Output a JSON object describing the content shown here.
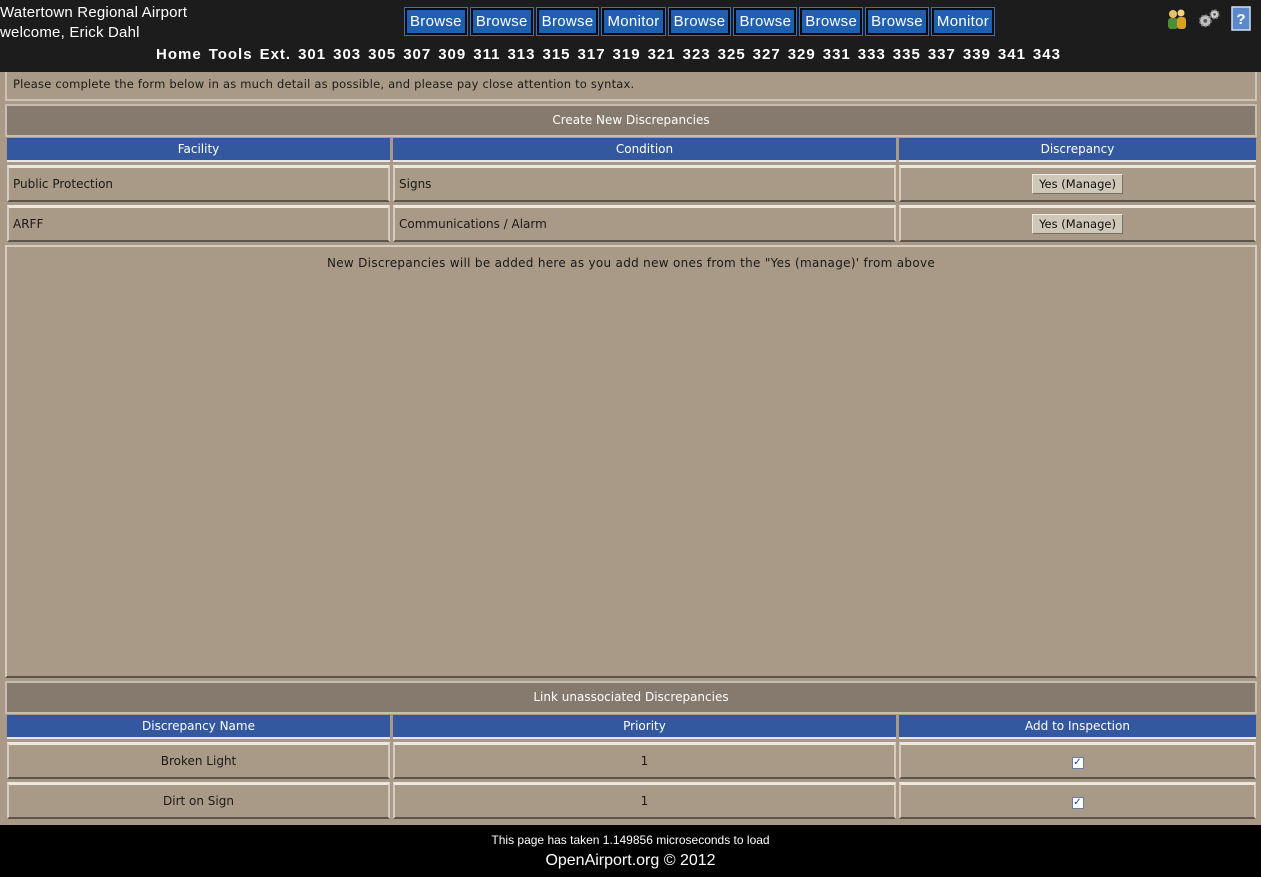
{
  "header": {
    "site_name": "Watertown Regional Airport",
    "welcome": "welcome, Erick Dahl",
    "top_buttons": [
      "Browse",
      "Browse",
      "Browse",
      "Monitor",
      "Browse",
      "Browse",
      "Browse",
      "Browse",
      "Monitor"
    ],
    "nav": [
      "Home",
      "Tools",
      "Ext.",
      "301",
      "303",
      "305",
      "307",
      "309",
      "311",
      "313",
      "315",
      "317",
      "319",
      "321",
      "323",
      "325",
      "327",
      "329",
      "331",
      "333",
      "335",
      "337",
      "339",
      "341",
      "343"
    ]
  },
  "instructions": "Please complete the form below in as much detail as possible, and please pay close attention to syntax.",
  "create_section": {
    "title": "Create New Discrepancies",
    "columns": [
      "Facility",
      "Condition",
      "Discrepancy"
    ],
    "rows": [
      {
        "facility": "Public Protection",
        "condition": "Signs",
        "action": "Yes (Manage)"
      },
      {
        "facility": "ARFF",
        "condition": "Communications / Alarm",
        "action": "Yes (Manage)"
      }
    ],
    "placeholder": "New Discrepancies will be added here as you add new ones from the \"Yes (manage)' from above"
  },
  "link_section": {
    "title": "Link unassociated Discrepancies",
    "columns": [
      "Discrepancy Name",
      "Priority",
      "Add to Inspection"
    ],
    "rows": [
      {
        "name": "Broken Light",
        "priority": "1",
        "checked": true
      },
      {
        "name": "Dirt on Sign",
        "priority": "1",
        "checked": true
      }
    ]
  },
  "footer": {
    "load_time": "This page has taken 1.149856 microseconds to load",
    "brand": "OpenAirport.org © 2012"
  },
  "icons": [
    "users-icon",
    "settings-gears-icon",
    "help-icon"
  ]
}
